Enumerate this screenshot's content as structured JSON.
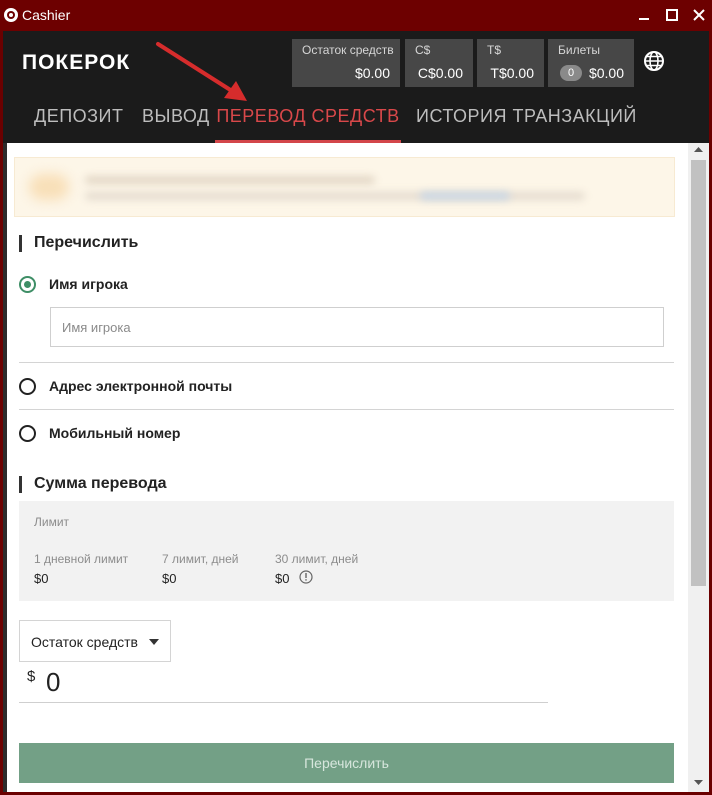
{
  "window": {
    "title": "Cashier"
  },
  "header": {
    "logo_text": "ПОКЕРОК",
    "balances": [
      {
        "label": "Остаток средств",
        "value": "$0.00"
      },
      {
        "label": "C$",
        "value": "C$0.00"
      },
      {
        "label": "T$",
        "value": "T$0.00"
      },
      {
        "label": "Билеты",
        "count": "0",
        "value": "$0.00"
      }
    ]
  },
  "tabs": [
    {
      "label": "ДЕПОЗИТ"
    },
    {
      "label": "ВЫВОД"
    },
    {
      "label": "ПЕРЕВОД СРЕДСТВ",
      "active": true
    },
    {
      "label": "ИСТОРИЯ ТРАНЗАКЦИЙ"
    }
  ],
  "transfer": {
    "section_title": "Перечислить",
    "options": [
      {
        "label": "Имя игрока",
        "checked": true
      },
      {
        "label": "Адрес электронной почты",
        "checked": false
      },
      {
        "label": "Мобильный номер",
        "checked": false
      }
    ],
    "player_placeholder": "Имя игрока"
  },
  "amount": {
    "section_title": "Сумма перевода",
    "limit_title": "Лимит",
    "limits": [
      {
        "label": "1 дневной лимит",
        "value": "$0"
      },
      {
        "label": "7 лимит, дней",
        "value": "$0"
      },
      {
        "label": "30 лимит, дней",
        "value": "$0"
      }
    ],
    "source_selected": "Остаток средств",
    "currency_symbol": "$",
    "amount_value": "0",
    "submit_label": "Перечислить"
  },
  "colors": {
    "titlebar": "#6d0000",
    "header_bg": "#1b1b1b",
    "accent_tab": "#d9484a",
    "radio_checked": "#3e8e66",
    "submit_bg": "#73a086",
    "arrow": "#d62c2c"
  },
  "icons": {
    "app": "app-icon",
    "globe": "globe-icon",
    "info": "info-icon",
    "caret": "caret-down-icon"
  }
}
